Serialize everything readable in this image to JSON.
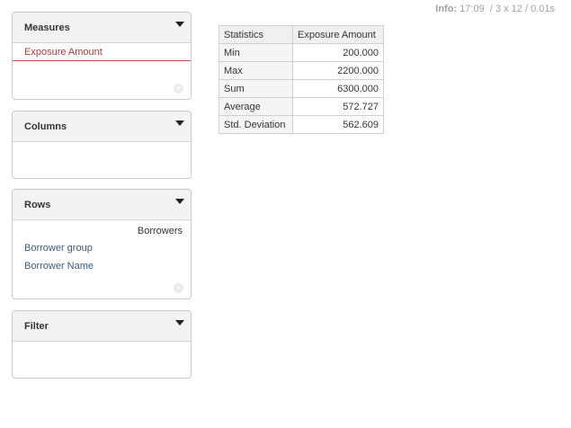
{
  "info": {
    "label": "Info:",
    "time": "17:09",
    "dims": "3 x 12",
    "duration": "0.01s"
  },
  "panels": {
    "measures": {
      "title": "Measures",
      "items": [
        "Exposure Amount"
      ]
    },
    "columns": {
      "title": "Columns"
    },
    "rows": {
      "title": "Rows",
      "header": "Borrowers",
      "items": [
        "Borrower group",
        "Borrower Name"
      ]
    },
    "filter": {
      "title": "Filter"
    }
  },
  "table": {
    "headers": [
      "Statistics",
      "Exposure Amount"
    ],
    "rows": [
      [
        "Min",
        "200.000"
      ],
      [
        "Max",
        "2200.000"
      ],
      [
        "Sum",
        "6300.000"
      ],
      [
        "Average",
        "572.727"
      ],
      [
        "Std. Deviation",
        "562.609"
      ]
    ]
  },
  "icons": {
    "dropdown": "caret-down-icon",
    "remove": "remove-circle-icon"
  },
  "colors": {
    "measure_text": "#a33b39",
    "measure_underline": "#c0504d",
    "link": "#3c5a7a"
  }
}
